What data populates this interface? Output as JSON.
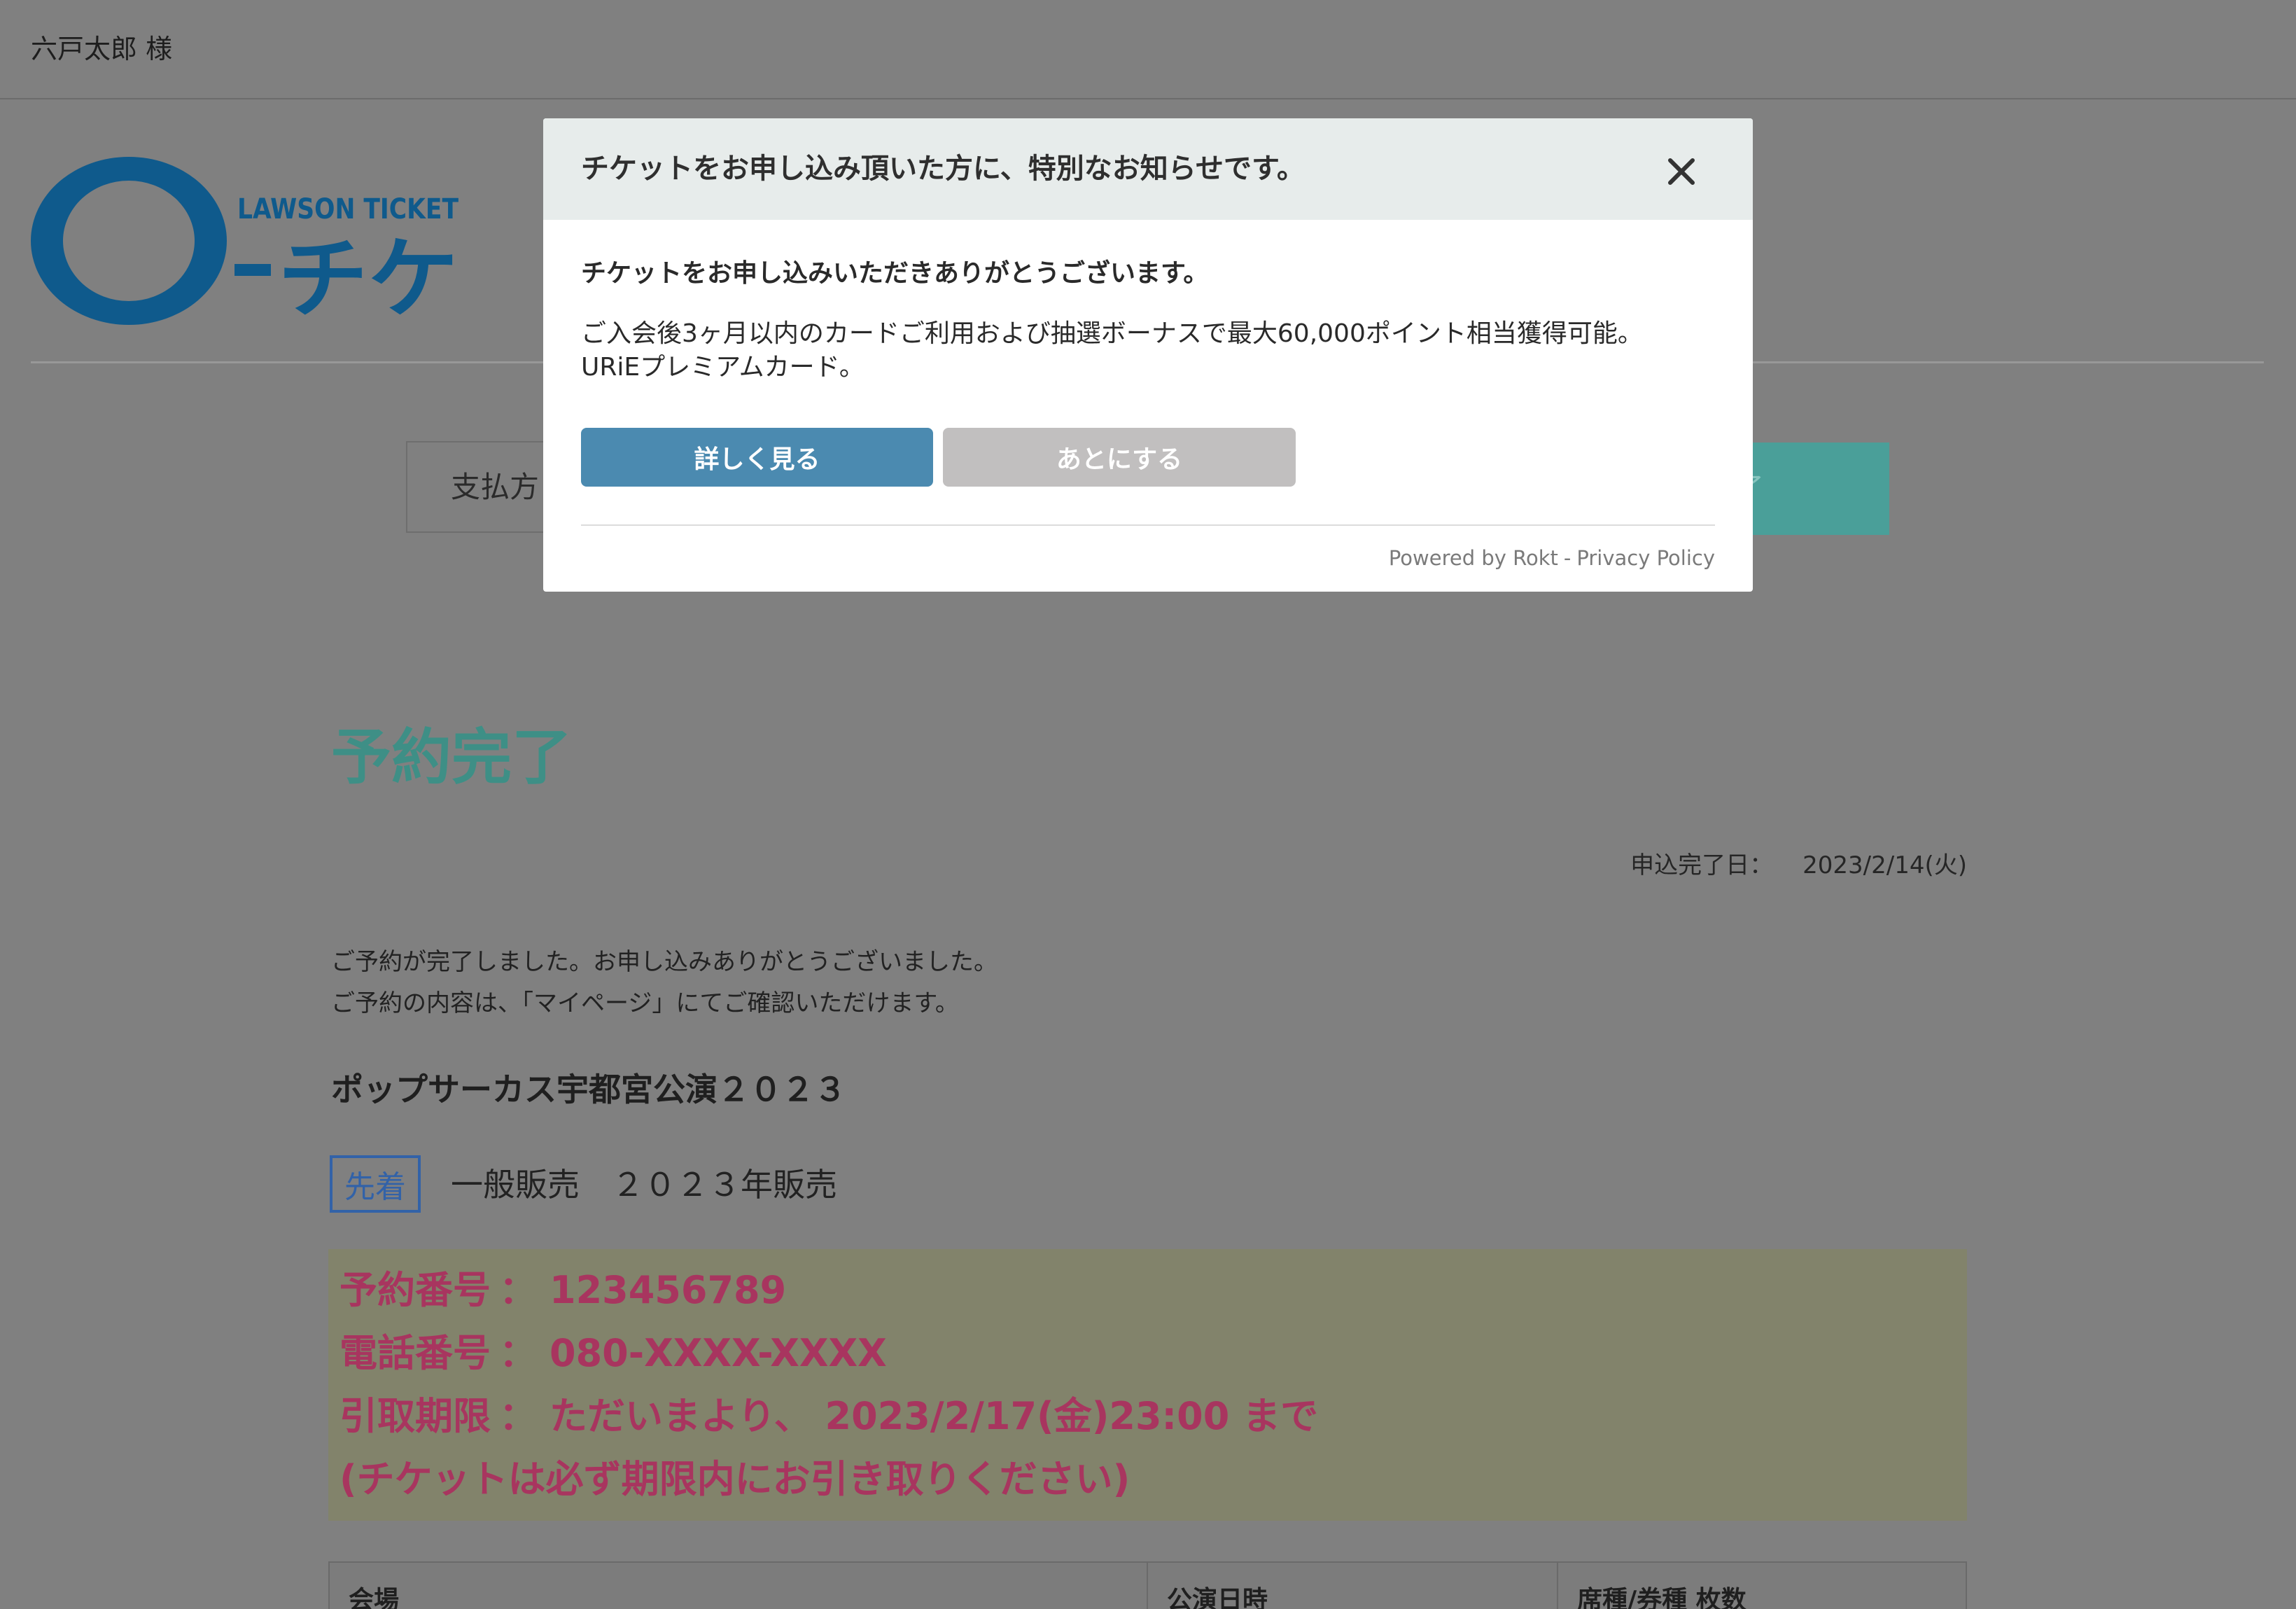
{
  "theme": {
    "page_bg": "#808080",
    "accent": "#3e8f86",
    "accent_step": "#4a9f99",
    "logo": "#0f5a8c",
    "alert": "#a8355f",
    "badge": "#3262a8",
    "primary": "#4b8ab0",
    "secondary": "#c1bfbf"
  },
  "header": {
    "user_name": "六戸太郎 様"
  },
  "logo": {
    "brand": "LAWSON TICKET",
    "wordmark": "チケ"
  },
  "steps": {
    "first_label": "支払方",
    "last_label": "了"
  },
  "page": {
    "title": "予約完了",
    "completion_date_label": "申込完了日：",
    "completion_date": "2023/2/14(火)",
    "messages": [
      "ご予約が完了しました。お申し込みありがとうございました。",
      "ご予約の内容は、「マイページ」にてご確認いただけます。"
    ],
    "event_title": "ポップサーカス宇都宮公演２０２３",
    "sale_badge": "先着",
    "sale_name": "一般販売　２０２３年販売",
    "reservation": [
      {
        "label": "予約番号",
        "separator": "：",
        "value": "123456789"
      },
      {
        "label": "電話番号",
        "separator": "：",
        "value": "080-XXXX-XXXX"
      },
      {
        "label": "引取期限",
        "separator": "：",
        "value": "ただいまより、 2023/2/17(金)23:00 まで"
      }
    ],
    "pickup_note": "(チケットは必ず期限内にお引き取りください)",
    "table_headers": [
      "会場",
      "公演日時",
      "席種/券種 枚数"
    ]
  },
  "modal": {
    "title": "チケットをお申し込み頂いた方に、特別なお知らせです。",
    "close_icon": "close-icon",
    "greeting": "チケットをお申し込みいただきありがとうございます。",
    "description": [
      "ご入会後3ヶ月以内のカードご利用および抽選ボーナスで最大60,000ポイント相当獲得可能。",
      "URiEプレミアムカード。"
    ],
    "primary_button": "詳しく見る",
    "secondary_button": "あとにする",
    "footer": {
      "powered_by": "Powered by Rokt",
      "separator": "-",
      "privacy_link": "Privacy Policy"
    }
  }
}
